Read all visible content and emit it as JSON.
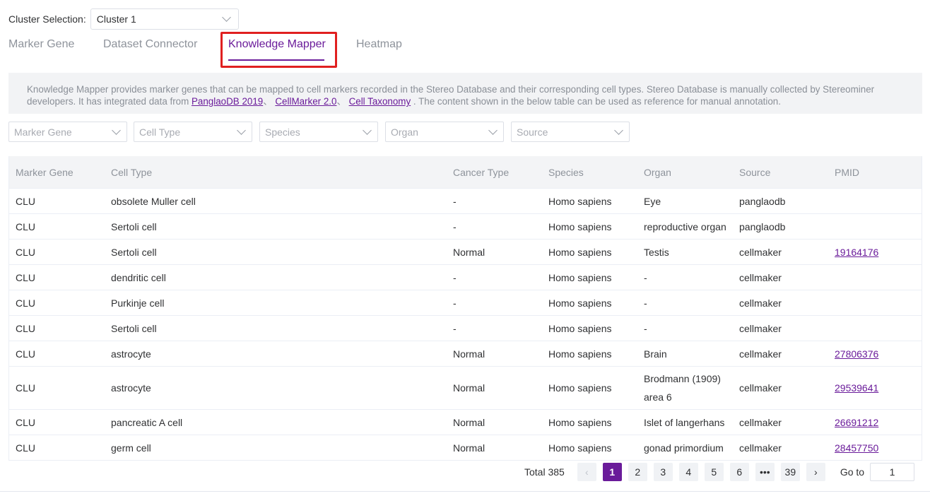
{
  "cluster": {
    "label": "Cluster Selection:",
    "value": "Cluster 1"
  },
  "tabs": [
    {
      "label": "Marker Gene"
    },
    {
      "label": "Dataset Connector"
    },
    {
      "label": "Knowledge Mapper"
    },
    {
      "label": "Heatmap"
    }
  ],
  "info": {
    "text_before": "Knowledge Mapper provides marker genes that can be mapped to cell markers recorded in the Stereo Database and their corresponding cell types. Stereo Database is manually collected by Stereominer developers. It has integrated data from ",
    "link1": "PanglaoDB 2019",
    "sep1": "、 ",
    "link2": "CellMarker 2.0",
    "sep2": "、 ",
    "link3": "Cell Taxonomy",
    "text_after": " . The content shown in the below table can be used as reference for manual annotation."
  },
  "filters": [
    {
      "placeholder": "Marker Gene"
    },
    {
      "placeholder": "Cell Type"
    },
    {
      "placeholder": "Species"
    },
    {
      "placeholder": "Organ"
    },
    {
      "placeholder": "Source"
    }
  ],
  "table": {
    "headers": [
      "Marker Gene",
      "Cell Type",
      "Cancer Type",
      "Species",
      "Organ",
      "Source",
      "PMID"
    ],
    "rows": [
      [
        "CLU",
        "obsolete Muller cell",
        "-",
        "Homo sapiens",
        "Eye",
        "panglaodb",
        ""
      ],
      [
        "CLU",
        "Sertoli cell",
        "-",
        "Homo sapiens",
        "reproductive organ",
        "panglaodb",
        ""
      ],
      [
        "CLU",
        "Sertoli cell",
        "Normal",
        "Homo sapiens",
        "Testis",
        "cellmaker",
        "19164176"
      ],
      [
        "CLU",
        "dendritic cell",
        "-",
        "Homo sapiens",
        "-",
        "cellmaker",
        ""
      ],
      [
        "CLU",
        "Purkinje cell",
        "-",
        "Homo sapiens",
        "-",
        "cellmaker",
        ""
      ],
      [
        "CLU",
        "Sertoli cell",
        "-",
        "Homo sapiens",
        "-",
        "cellmaker",
        ""
      ],
      [
        "CLU",
        "astrocyte",
        "Normal",
        "Homo sapiens",
        "Brain",
        "cellmaker",
        "27806376"
      ],
      [
        "CLU",
        "astrocyte",
        "Normal",
        "Homo sapiens",
        "Brodmann (1909) area 6",
        "cellmaker",
        "29539641"
      ],
      [
        "CLU",
        "pancreatic A cell",
        "Normal",
        "Homo sapiens",
        "Islet of langerhans",
        "cellmaker",
        "26691212"
      ],
      [
        "CLU",
        "germ cell",
        "Normal",
        "Homo sapiens",
        "gonad primordium",
        "cellmaker",
        "28457750"
      ]
    ]
  },
  "pagination": {
    "total": "Total 385",
    "pages": [
      "1",
      "2",
      "3",
      "4",
      "5",
      "6",
      "•••",
      "39"
    ],
    "prev": "‹",
    "next": "›",
    "goto_label": "Go to",
    "goto_value": "1"
  },
  "colors": {
    "accent": "#6a1b9a",
    "highlight": "#e02020"
  }
}
